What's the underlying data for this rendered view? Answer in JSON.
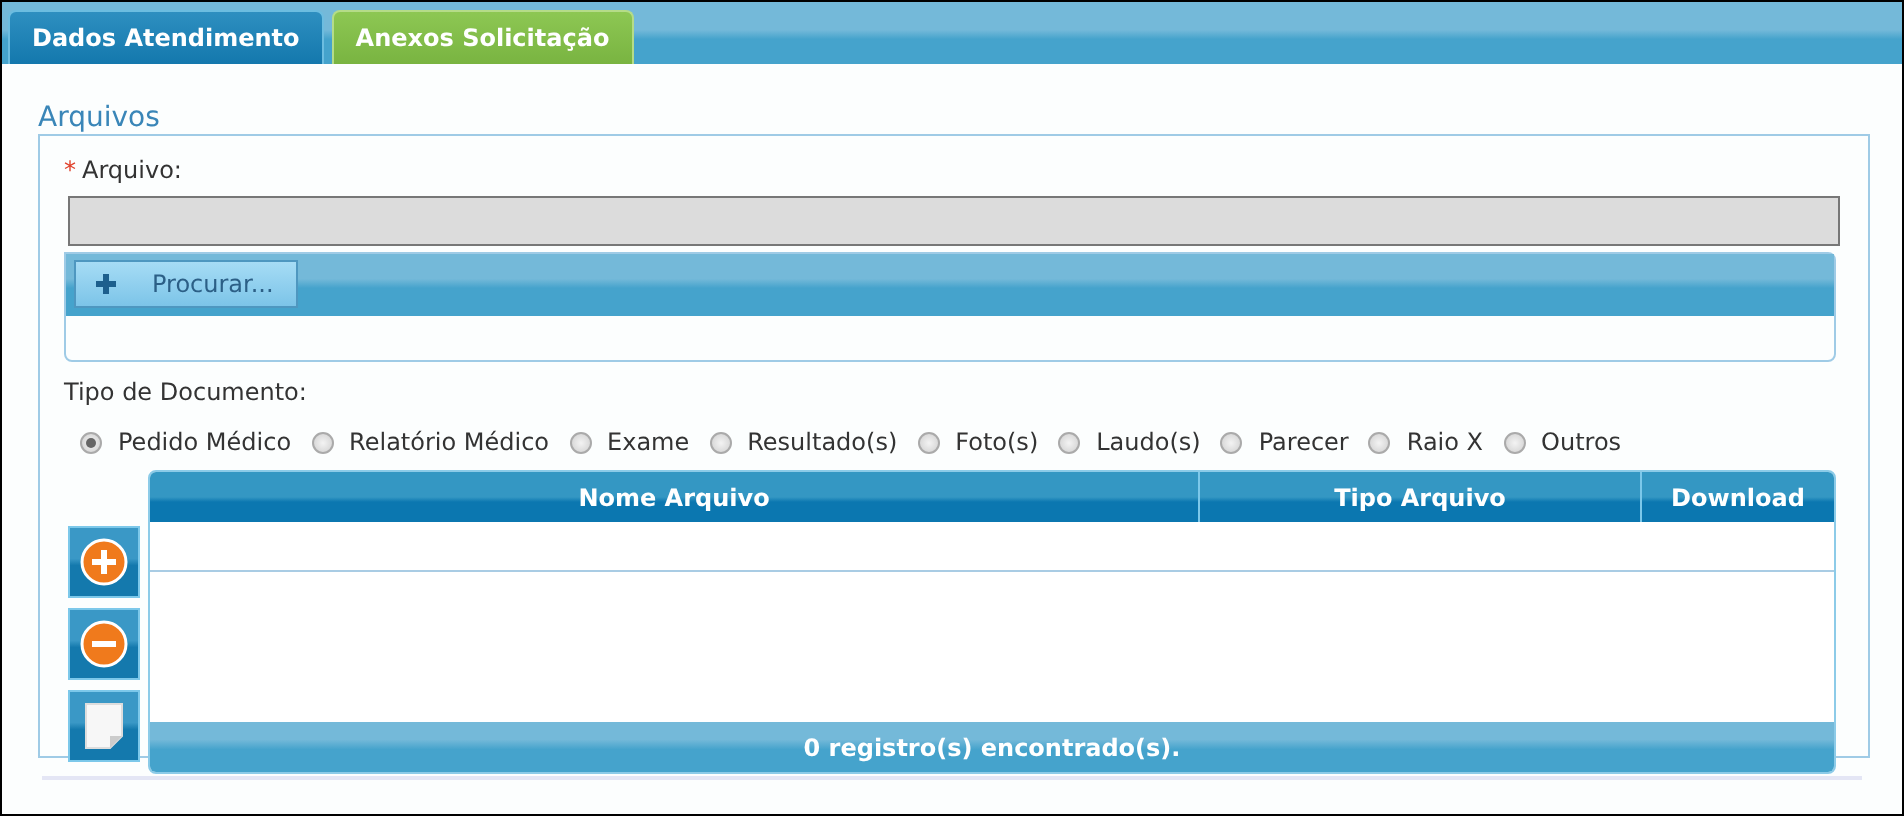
{
  "tabs": [
    {
      "label": "Dados Atendimento",
      "selected": false
    },
    {
      "label": "Anexos Solicitação",
      "selected": true
    }
  ],
  "section": {
    "title": "Arquivos",
    "file_field": {
      "required_mark": "*",
      "label": "Arquivo:"
    },
    "browse_button": {
      "label": "Procurar..."
    },
    "document_type": {
      "label": "Tipo de Documento:",
      "options": [
        {
          "label": "Pedido Médico",
          "selected": true
        },
        {
          "label": "Relatório Médico",
          "selected": false
        },
        {
          "label": "Exame",
          "selected": false
        },
        {
          "label": "Resultado(s)",
          "selected": false
        },
        {
          "label": "Foto(s)",
          "selected": false
        },
        {
          "label": "Laudo(s)",
          "selected": false
        },
        {
          "label": "Parecer",
          "selected": false
        },
        {
          "label": "Raio X",
          "selected": false
        },
        {
          "label": "Outros",
          "selected": false
        }
      ]
    },
    "side_buttons": [
      {
        "kind": "add"
      },
      {
        "kind": "remove"
      },
      {
        "kind": "document"
      }
    ],
    "table": {
      "columns": [
        "Nome Arquivo",
        "Tipo Arquivo",
        "Download"
      ],
      "footer": "0 registro(s) encontrado(s)."
    }
  }
}
